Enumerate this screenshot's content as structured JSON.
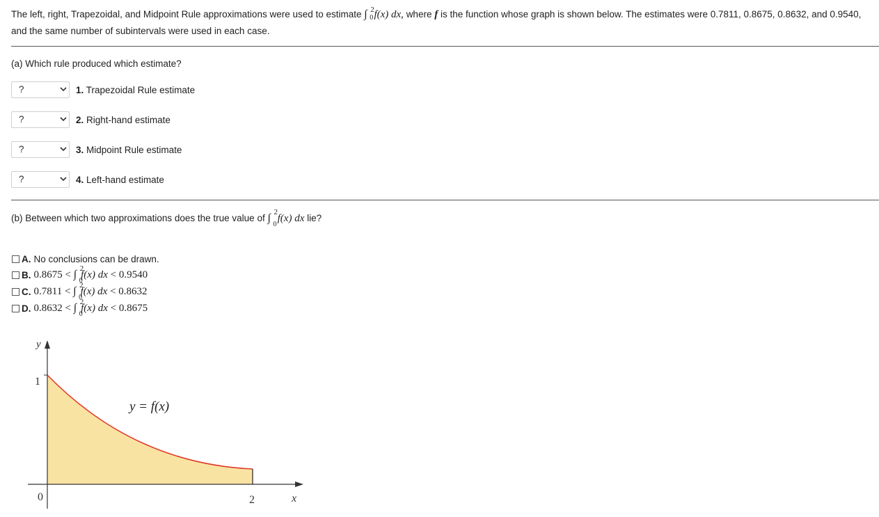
{
  "intro": {
    "part1": "The left, right, Trapezoidal, and Midpoint Rule approximations were used to estimate",
    "integral_upper": "2",
    "integral_lower": "0",
    "integrand": "f(x) dx,",
    "part2": "where",
    "fsym": "f",
    "part3": "is the function whose graph is shown below. The estimates were 0.7811, 0.8675, 0.8632, and 0.9540, and the same number of subintervals were used in each case."
  },
  "part_a": {
    "question": "(a) Which rule produced which estimate?",
    "rows": [
      {
        "value": "?",
        "num": "1.",
        "label": "Trapezoidal Rule estimate"
      },
      {
        "value": "?",
        "num": "2.",
        "label": "Right-hand estimate"
      },
      {
        "value": "?",
        "num": "3.",
        "label": "Midpoint Rule estimate"
      },
      {
        "value": "?",
        "num": "4.",
        "label": "Left-hand estimate"
      }
    ]
  },
  "part_b": {
    "question_pre": "(b) Between which two approximations does the true value of",
    "integral_upper": "2",
    "integral_lower": "0",
    "integrand": "f(x) dx",
    "question_post": "lie?",
    "options": [
      {
        "letter": "A.",
        "text": "No conclusions can be drawn."
      },
      {
        "letter": "B.",
        "left": "0.8675 <",
        "integrand": "f(x) dx",
        "right": "< 0.9540",
        "upper": "2",
        "lower": "0"
      },
      {
        "letter": "C.",
        "left": "0.7811 <",
        "integrand": "f(x) dx",
        "right": "< 0.8632",
        "upper": "2",
        "lower": "0"
      },
      {
        "letter": "D.",
        "left": "0.8632 <",
        "integrand": "f(x) dx",
        "right": "< 0.8675",
        "upper": "2",
        "lower": "0"
      }
    ]
  },
  "graph": {
    "y_label": "y",
    "x_label": "x",
    "y_tick": "1",
    "origin": "0",
    "x_tick": "2",
    "curve_label": "y = f(x)",
    "curve_color": "#e03a2a",
    "fill_color": "#f9e3a3"
  },
  "colors": {
    "text": "#1f1f1f",
    "rule": "#555555"
  }
}
